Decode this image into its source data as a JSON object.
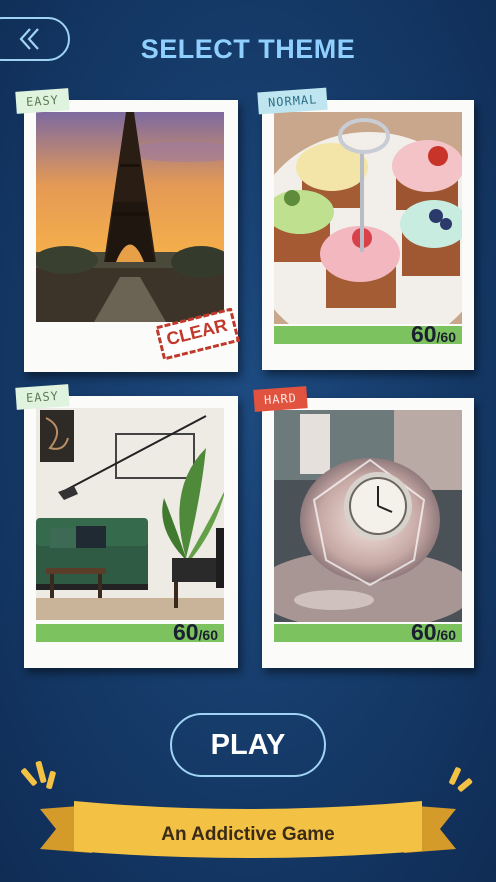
{
  "header": {
    "title": "SELECT THEME",
    "back_icon": "double-chevron-left-icon"
  },
  "themes": [
    {
      "difficulty": "EASY",
      "subject": "eiffel tower",
      "progress": 1.0,
      "stamp": "CLEAR",
      "tag_color": "#dff3df"
    },
    {
      "difficulty": "NORMAL",
      "subject": "cupcakes",
      "progress": 1.0,
      "score": "60",
      "total": "/60",
      "tag_color": "#bfe6f0"
    },
    {
      "difficulty": "EASY",
      "subject": "living room",
      "progress": 1.0,
      "score": "60",
      "total": "/60",
      "tag_color": "#dff3df"
    },
    {
      "difficulty": "HARD",
      "subject": "crystal clock",
      "progress": 1.0,
      "score": "60",
      "total": "/60",
      "tag_color": "#e2533f"
    }
  ],
  "play_button": {
    "label": "PLAY"
  },
  "banner": {
    "text": "An Addictive Game"
  },
  "colors": {
    "accent": "#8fd0ff",
    "progress": "#7cc35f",
    "banner": "#f3c245"
  }
}
